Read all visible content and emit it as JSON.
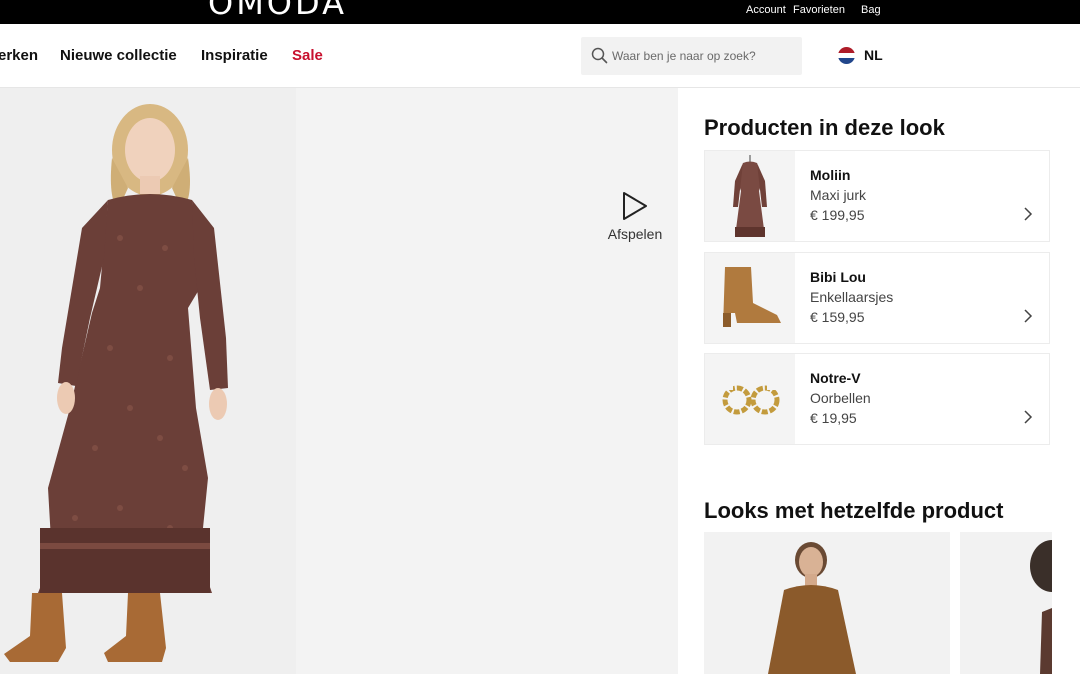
{
  "header": {
    "logo": "OMODA",
    "links": [
      "Account",
      "Favorieten",
      "Bag"
    ]
  },
  "nav": {
    "items": [
      "erken",
      "Nieuwe collectie",
      "Inspiratie",
      "Sale"
    ],
    "search_placeholder": "Waar ben je naar op zoek?",
    "language": "NL"
  },
  "player": {
    "play_label": "Afspelen"
  },
  "products": {
    "title": "Producten in deze look",
    "items": [
      {
        "brand": "Moliin",
        "type": "Maxi jurk",
        "price": "€ 199,95"
      },
      {
        "brand": "Bibi Lou",
        "type": "Enkellaarsjes",
        "price": "€ 159,95"
      },
      {
        "brand": "Notre-V",
        "type": "Oorbellen",
        "price": "€ 19,95"
      }
    ]
  },
  "looks": {
    "title": "Looks met hetzelfde product"
  },
  "colors": {
    "sale": "#c8102e",
    "topbar": "#000000",
    "dress": "#6b3f38",
    "boots": "#a86a35"
  },
  "icons": {
    "search": "search-icon",
    "play": "play-icon",
    "chevron": "chevron-right-icon",
    "flag": "flag-nl-icon"
  }
}
